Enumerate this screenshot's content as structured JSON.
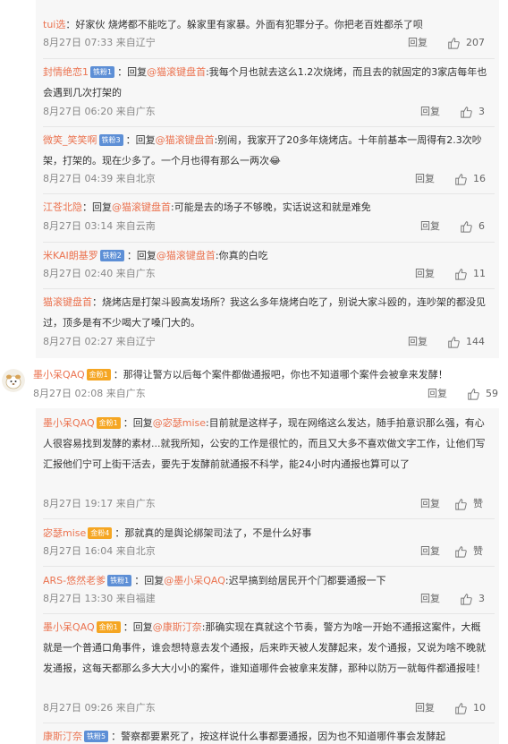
{
  "actions": {
    "reply": "回复",
    "like_label": "赞"
  },
  "nested_top": [
    {
      "user": "tui选",
      "badge": "",
      "text": "：好家伙 烧烤都不能吃了。躲家里有家暴。外面有犯罪分子。你把老百姓都杀了呗",
      "time": "8月27日 07:33",
      "source": "来自辽宁",
      "likes": "207"
    },
    {
      "user": "封情绝恋1",
      "badge": "铁粉1",
      "pre": "：回复",
      "at": "@猫滚键盘首",
      "text": ":我每个月也就去这么1.2次烧烤，而且去的就固定的3家店每年也会遇到几次打架的",
      "time": "8月27日 06:20",
      "source": "来自广东",
      "likes": "3"
    },
    {
      "user": "微笑_笑笑啊",
      "badge": "铁粉3",
      "pre": "：回复",
      "at": "@猫滚键盘首",
      "text": ":别闹，我家开了20多年烧烤店。十年前基本一周得有2.3次吵架，打架的。现在少多了。一个月也得有那么一两次😂",
      "time": "8月27日 04:39",
      "source": "来自北京",
      "likes": "16"
    },
    {
      "user": "江苍北隐",
      "badge": "",
      "pre": "：回复",
      "at": "@猫滚键盘首",
      "text": ":可能是去的场子不够晚，实话说这和就是难免",
      "time": "8月27日 03:14",
      "source": "来自云南",
      "likes": "6"
    },
    {
      "user": "米KAI朗基罗",
      "badge": "铁粉2",
      "pre": "：回复",
      "at": "@猫滚键盘首",
      "text": ":你真的白吃",
      "time": "8月27日 02:40",
      "source": "来自广东",
      "likes": "11"
    },
    {
      "user": "猫滚键盘首",
      "badge": "",
      "text": "：烧烤店是打架斗殴高发场所？我这么多年烧烤白吃了，别说大家斗殴的，连吵架的都没见过，顶多是有不少喝大了嗓门大的。",
      "time": "8月27日 02:27",
      "source": "来自辽宁",
      "likes": "144"
    }
  ],
  "main_comment": {
    "user": "墨小呆QAQ",
    "badge": "金粉1",
    "text": "：那得让警方以后每个案件都做通报吧，你也不知道哪个案件会被拿来发酵！",
    "time": "8月27日 02:08",
    "source": "来自广东",
    "likes": "59"
  },
  "nested_bottom": [
    {
      "user": "墨小呆QAQ",
      "badge": "金粉1",
      "pre": "：回复",
      "at": "@宓瑟mise",
      "text": ":目前就是这样子，现在网络这么发达，随手拍意识那么强，有心人很容易找到发酵的素材...就我所知，公安的工作是很忙的，而且又大多不喜欢做文字工作，让他们写汇报他们宁可上街干活去，要先于发酵前就通报不科学，能24小时内通报也算可以了",
      "time": "8月27日 19:17",
      "source": "来自广东",
      "likes": ""
    },
    {
      "user": "宓瑟mise",
      "badge": "金粉4",
      "text": "：那就真的是舆论绑架司法了，不是什么好事",
      "time": "8月27日 16:04",
      "source": "来自北京",
      "likes": ""
    },
    {
      "user": "ARS-悠然老爹",
      "badge": "铁粉1",
      "pre": "：回复",
      "at": "@墨小呆QAQ",
      "text": ":迟早搞到给居民开个门都要通报一下",
      "time": "8月27日 13:30",
      "source": "来自福建",
      "likes": "3"
    },
    {
      "user": "墨小呆QAQ",
      "badge": "金粉1",
      "pre": "：回复",
      "at": "@康斯汀奈",
      "text": ":那确实现在真就这个节奏，警方为啥一开始不通报这案件，大概就是一个普通口角事件，谁会想特意去发个通报，后来昨天被人发酵起来，发个通报，又说为啥不晚就发通报，这每天都那么多大大小小的案件，谁知道哪件会被拿来发酵，那种以防万一就每件都通报哇！",
      "time": "8月27日 09:26",
      "source": "来自广东",
      "likes": "10"
    },
    {
      "user": "康斯汀奈",
      "badge": "铁粉5",
      "text": "：警察都要累死了，按这样说什么事都要通报，因为也不知道哪件事会发酵起",
      "time": "",
      "source": "",
      "likes": ""
    }
  ]
}
